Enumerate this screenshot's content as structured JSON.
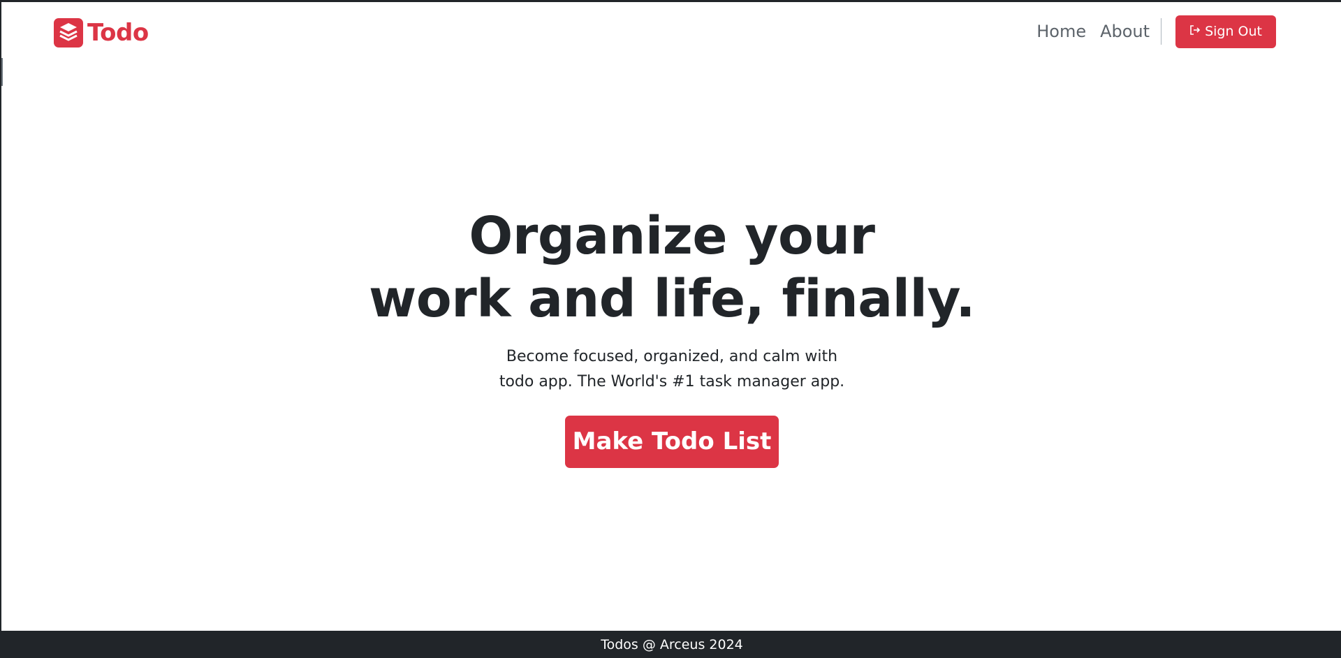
{
  "brand": {
    "name": "Todo",
    "icon": "stacked-layers-icon",
    "color": "#dc3545"
  },
  "nav": {
    "items": [
      {
        "label": "Home"
      },
      {
        "label": "About"
      }
    ],
    "signout": {
      "label": "Sign Out",
      "icon": "sign-out-icon"
    }
  },
  "hero": {
    "title_line1": "Organize your",
    "title_line2": "work and life, finally.",
    "subtitle_line1": "Become focused, organized, and calm with",
    "subtitle_line2": "todo app. The World's #1 task manager app.",
    "cta_label": "Make Todo List"
  },
  "footer": {
    "text": "Todos @ Arceus 2024"
  },
  "colors": {
    "accent": "#dc3545",
    "dark": "#212529",
    "nav_text": "#5c636a"
  }
}
